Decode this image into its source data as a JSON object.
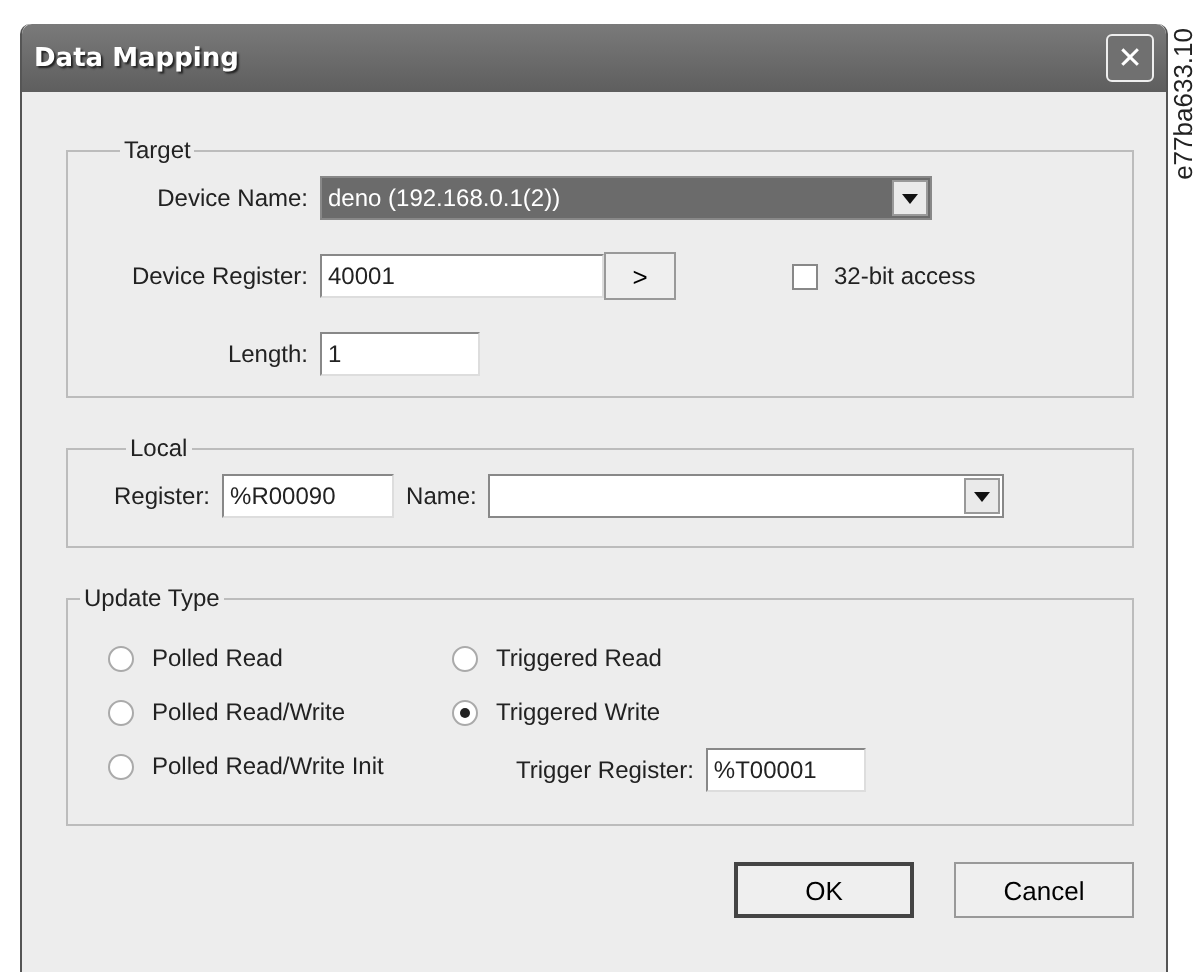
{
  "window": {
    "title": "Data Mapping",
    "close": "✕"
  },
  "target": {
    "legend": "Target",
    "device_name": {
      "label": "Device Name:",
      "value": "deno (192.168.0.1(2))"
    },
    "device_register": {
      "label": "Device Register:",
      "value": "40001",
      "button": ">"
    },
    "access_32bit": {
      "label": "32-bit access",
      "checked": false
    },
    "length": {
      "label": "Length:",
      "value": "1"
    }
  },
  "local": {
    "legend": "Local",
    "register": {
      "label": "Register:",
      "value": "%R00090"
    },
    "name": {
      "label": "Name:"
    }
  },
  "update_type": {
    "legend": "Update Type",
    "options": [
      {
        "label": "Polled Read",
        "selected": false
      },
      {
        "label": "Triggered Read",
        "selected": false
      },
      {
        "label": "Polled Read/Write",
        "selected": false
      },
      {
        "label": "Triggered Write",
        "selected": true
      },
      {
        "label": "Polled Read/Write Init",
        "selected": false
      }
    ],
    "trigger_register": {
      "label": "Trigger Register:",
      "value": "%T00001"
    }
  },
  "buttons": [
    "OK",
    "Cancel"
  ],
  "figure_id": "e77ba633.10"
}
